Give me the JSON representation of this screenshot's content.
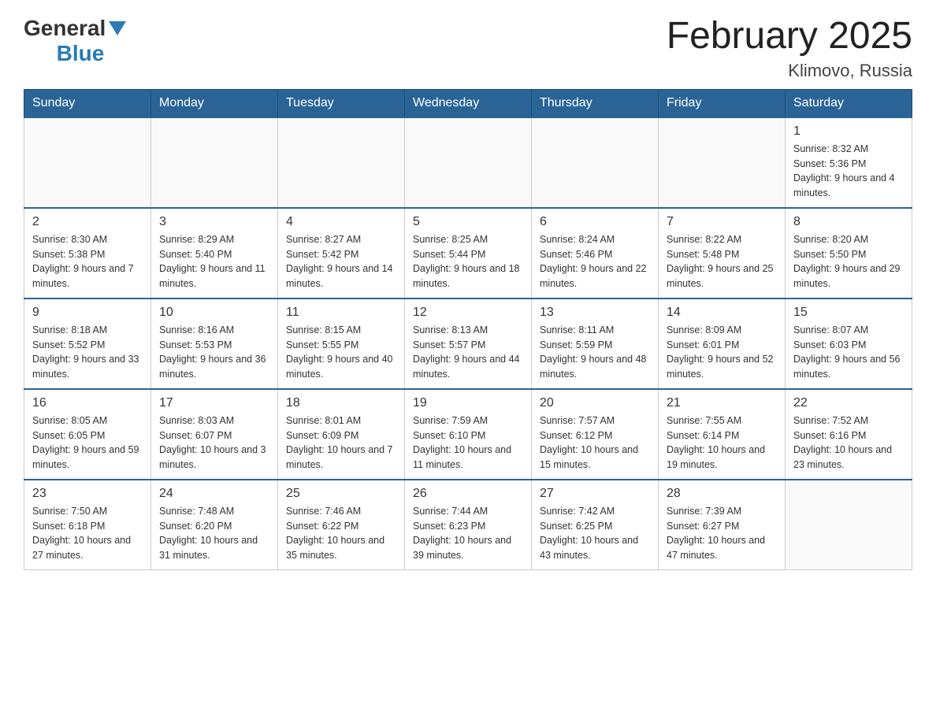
{
  "header": {
    "logo": {
      "general": "General",
      "blue": "Blue"
    },
    "title": "February 2025",
    "subtitle": "Klimovo, Russia"
  },
  "weekdays": [
    "Sunday",
    "Monday",
    "Tuesday",
    "Wednesday",
    "Thursday",
    "Friday",
    "Saturday"
  ],
  "weeks": [
    [
      {
        "day": "",
        "info": ""
      },
      {
        "day": "",
        "info": ""
      },
      {
        "day": "",
        "info": ""
      },
      {
        "day": "",
        "info": ""
      },
      {
        "day": "",
        "info": ""
      },
      {
        "day": "",
        "info": ""
      },
      {
        "day": "1",
        "info": "Sunrise: 8:32 AM\nSunset: 5:36 PM\nDaylight: 9 hours and 4 minutes."
      }
    ],
    [
      {
        "day": "2",
        "info": "Sunrise: 8:30 AM\nSunset: 5:38 PM\nDaylight: 9 hours and 7 minutes."
      },
      {
        "day": "3",
        "info": "Sunrise: 8:29 AM\nSunset: 5:40 PM\nDaylight: 9 hours and 11 minutes."
      },
      {
        "day": "4",
        "info": "Sunrise: 8:27 AM\nSunset: 5:42 PM\nDaylight: 9 hours and 14 minutes."
      },
      {
        "day": "5",
        "info": "Sunrise: 8:25 AM\nSunset: 5:44 PM\nDaylight: 9 hours and 18 minutes."
      },
      {
        "day": "6",
        "info": "Sunrise: 8:24 AM\nSunset: 5:46 PM\nDaylight: 9 hours and 22 minutes."
      },
      {
        "day": "7",
        "info": "Sunrise: 8:22 AM\nSunset: 5:48 PM\nDaylight: 9 hours and 25 minutes."
      },
      {
        "day": "8",
        "info": "Sunrise: 8:20 AM\nSunset: 5:50 PM\nDaylight: 9 hours and 29 minutes."
      }
    ],
    [
      {
        "day": "9",
        "info": "Sunrise: 8:18 AM\nSunset: 5:52 PM\nDaylight: 9 hours and 33 minutes."
      },
      {
        "day": "10",
        "info": "Sunrise: 8:16 AM\nSunset: 5:53 PM\nDaylight: 9 hours and 36 minutes."
      },
      {
        "day": "11",
        "info": "Sunrise: 8:15 AM\nSunset: 5:55 PM\nDaylight: 9 hours and 40 minutes."
      },
      {
        "day": "12",
        "info": "Sunrise: 8:13 AM\nSunset: 5:57 PM\nDaylight: 9 hours and 44 minutes."
      },
      {
        "day": "13",
        "info": "Sunrise: 8:11 AM\nSunset: 5:59 PM\nDaylight: 9 hours and 48 minutes."
      },
      {
        "day": "14",
        "info": "Sunrise: 8:09 AM\nSunset: 6:01 PM\nDaylight: 9 hours and 52 minutes."
      },
      {
        "day": "15",
        "info": "Sunrise: 8:07 AM\nSunset: 6:03 PM\nDaylight: 9 hours and 56 minutes."
      }
    ],
    [
      {
        "day": "16",
        "info": "Sunrise: 8:05 AM\nSunset: 6:05 PM\nDaylight: 9 hours and 59 minutes."
      },
      {
        "day": "17",
        "info": "Sunrise: 8:03 AM\nSunset: 6:07 PM\nDaylight: 10 hours and 3 minutes."
      },
      {
        "day": "18",
        "info": "Sunrise: 8:01 AM\nSunset: 6:09 PM\nDaylight: 10 hours and 7 minutes."
      },
      {
        "day": "19",
        "info": "Sunrise: 7:59 AM\nSunset: 6:10 PM\nDaylight: 10 hours and 11 minutes."
      },
      {
        "day": "20",
        "info": "Sunrise: 7:57 AM\nSunset: 6:12 PM\nDaylight: 10 hours and 15 minutes."
      },
      {
        "day": "21",
        "info": "Sunrise: 7:55 AM\nSunset: 6:14 PM\nDaylight: 10 hours and 19 minutes."
      },
      {
        "day": "22",
        "info": "Sunrise: 7:52 AM\nSunset: 6:16 PM\nDaylight: 10 hours and 23 minutes."
      }
    ],
    [
      {
        "day": "23",
        "info": "Sunrise: 7:50 AM\nSunset: 6:18 PM\nDaylight: 10 hours and 27 minutes."
      },
      {
        "day": "24",
        "info": "Sunrise: 7:48 AM\nSunset: 6:20 PM\nDaylight: 10 hours and 31 minutes."
      },
      {
        "day": "25",
        "info": "Sunrise: 7:46 AM\nSunset: 6:22 PM\nDaylight: 10 hours and 35 minutes."
      },
      {
        "day": "26",
        "info": "Sunrise: 7:44 AM\nSunset: 6:23 PM\nDaylight: 10 hours and 39 minutes."
      },
      {
        "day": "27",
        "info": "Sunrise: 7:42 AM\nSunset: 6:25 PM\nDaylight: 10 hours and 43 minutes."
      },
      {
        "day": "28",
        "info": "Sunrise: 7:39 AM\nSunset: 6:27 PM\nDaylight: 10 hours and 47 minutes."
      },
      {
        "day": "",
        "info": ""
      }
    ]
  ]
}
